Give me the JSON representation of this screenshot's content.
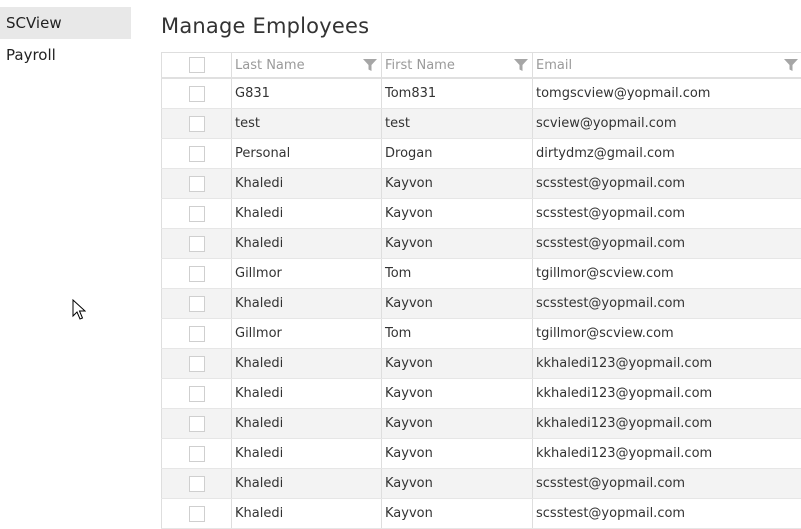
{
  "sidebar": {
    "items": [
      {
        "label": "SCView"
      },
      {
        "label": "Payroll"
      }
    ]
  },
  "main": {
    "title": "Manage Employees"
  },
  "grid": {
    "columns": [
      {
        "label": "Last Name"
      },
      {
        "label": "First Name"
      },
      {
        "label": "Email"
      }
    ],
    "rows": [
      {
        "last": "G831",
        "first": "Tom831",
        "email": "tomgscview@yopmail.com"
      },
      {
        "last": "test",
        "first": "test",
        "email": "scview@yopmail.com"
      },
      {
        "last": "Personal",
        "first": "Drogan",
        "email": "dirtydmz@gmail.com"
      },
      {
        "last": "Khaledi",
        "first": "Kayvon",
        "email": "scsstest@yopmail.com"
      },
      {
        "last": "Khaledi",
        "first": "Kayvon",
        "email": "scsstest@yopmail.com"
      },
      {
        "last": "Khaledi",
        "first": "Kayvon",
        "email": "scsstest@yopmail.com"
      },
      {
        "last": "Gillmor",
        "first": "Tom",
        "email": "tgillmor@scview.com"
      },
      {
        "last": "Khaledi",
        "first": "Kayvon",
        "email": "scsstest@yopmail.com"
      },
      {
        "last": "Gillmor",
        "first": "Tom",
        "email": "tgillmor@scview.com"
      },
      {
        "last": "Khaledi",
        "first": "Kayvon",
        "email": "kkhaledi123@yopmail.com"
      },
      {
        "last": "Khaledi",
        "first": "Kayvon",
        "email": "kkhaledi123@yopmail.com"
      },
      {
        "last": "Khaledi",
        "first": "Kayvon",
        "email": "kkhaledi123@yopmail.com"
      },
      {
        "last": "Khaledi",
        "first": "Kayvon",
        "email": "kkhaledi123@yopmail.com"
      },
      {
        "last": "Khaledi",
        "first": "Kayvon",
        "email": "scsstest@yopmail.com"
      },
      {
        "last": "Khaledi",
        "first": "Kayvon",
        "email": "scsstest@yopmail.com"
      }
    ]
  },
  "icons": {
    "filter": "filter-icon",
    "cursor": "mouse-pointer-icon"
  },
  "colors": {
    "sidebar_active_bg": "#e8e8e8",
    "row_alt_bg": "#f3f3f3",
    "header_text": "#9a9a9a",
    "filter_icon": "#a6a6a6"
  }
}
